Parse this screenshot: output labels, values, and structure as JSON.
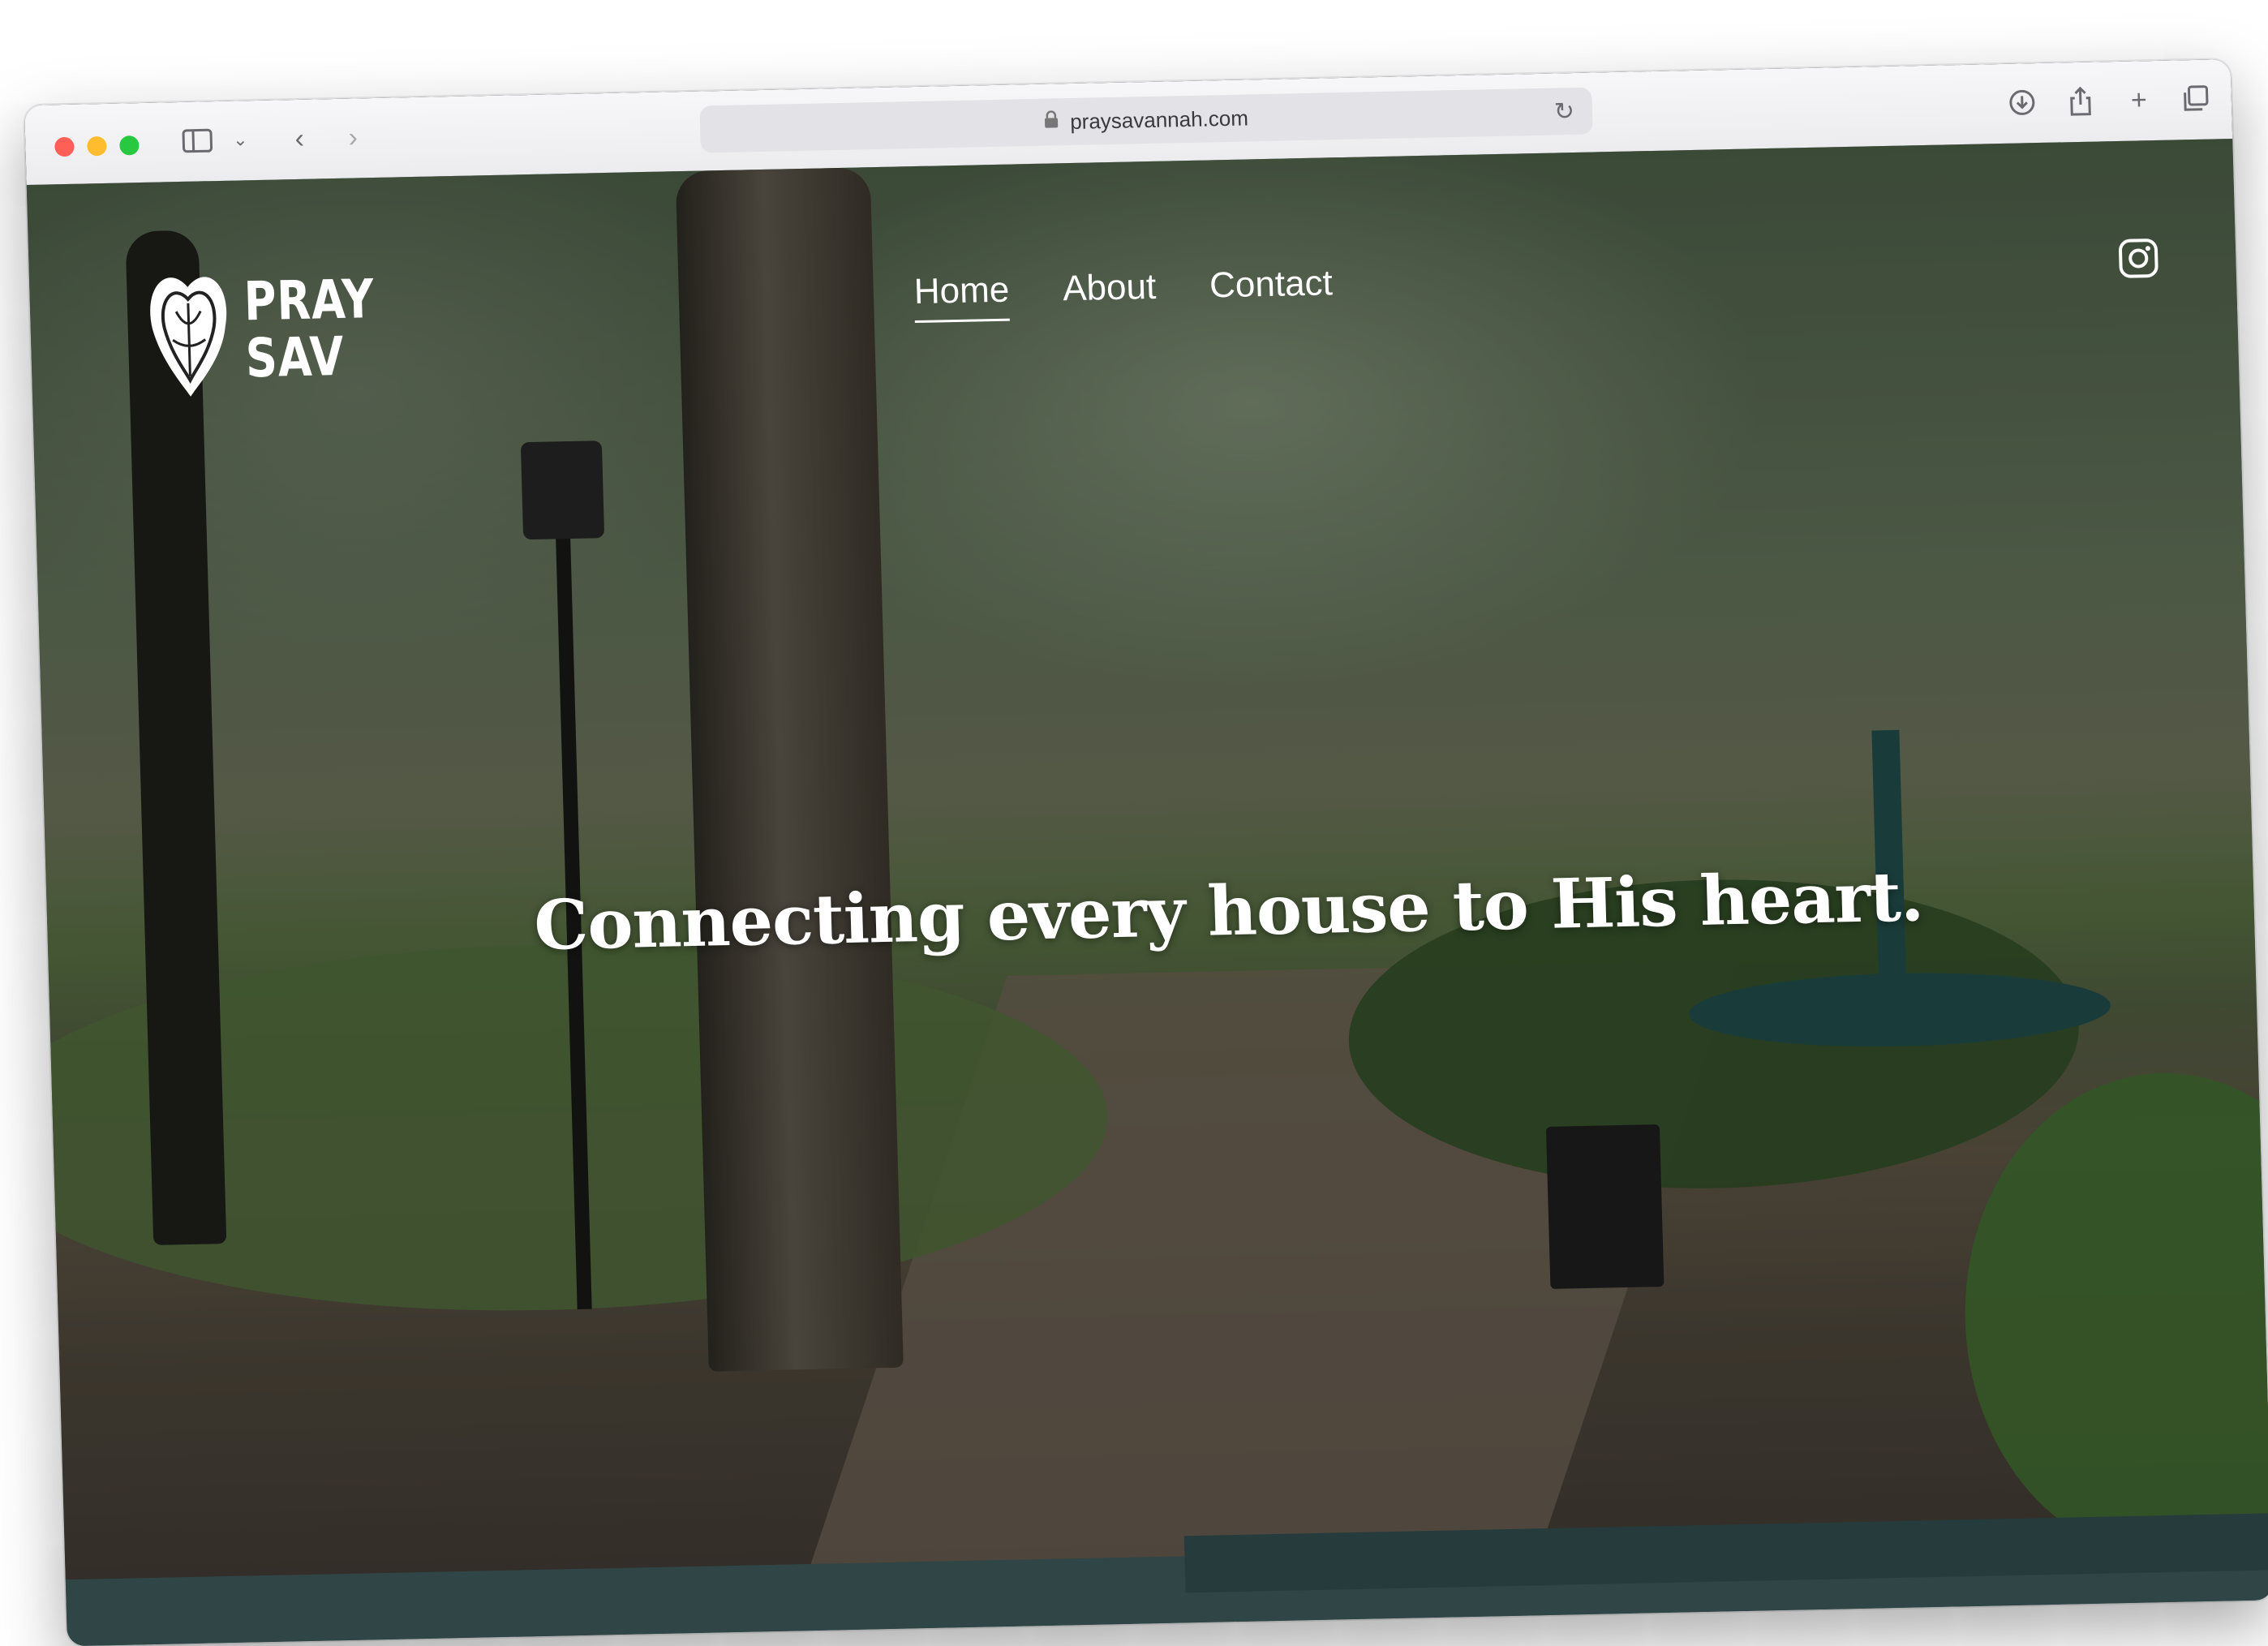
{
  "browser": {
    "url": "praysavannah.com",
    "icons": [
      "sidebar-icon",
      "chevron-down-icon",
      "back-icon",
      "forward-icon",
      "lock-icon",
      "reload-icon",
      "download-icon",
      "share-icon",
      "new-tab-icon",
      "tabs-overview-icon"
    ]
  },
  "site": {
    "logo": {
      "line1": "PRAY",
      "line2": "SAV"
    },
    "nav": [
      {
        "label": "Home",
        "active": true
      },
      {
        "label": "About",
        "active": false
      },
      {
        "label": "Contact",
        "active": false
      }
    ],
    "social_icon": "instagram-icon",
    "hero": {
      "headline": "Connecting every house to His heart."
    }
  },
  "colors": {
    "footer_band": "#2f4546",
    "nav_text": "#ffffff"
  }
}
